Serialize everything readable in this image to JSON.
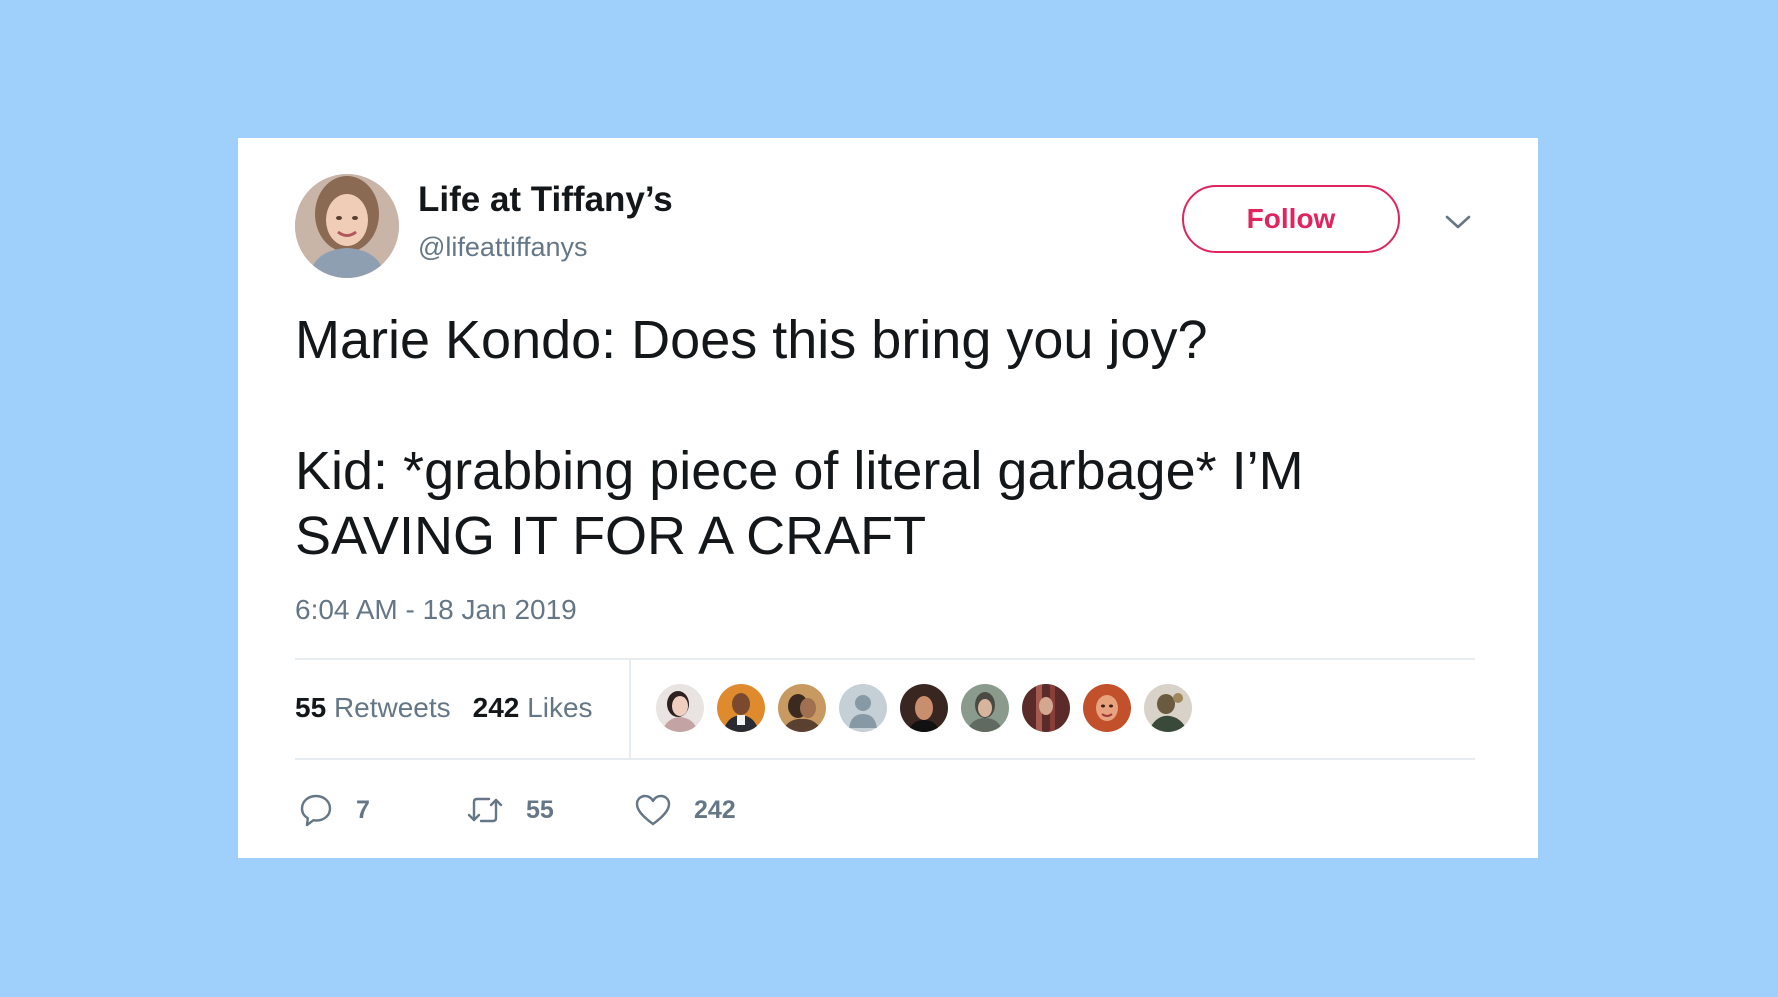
{
  "tweet": {
    "author_name": "Life at Tiffany’s",
    "author_handle": "@lifeattiffanys",
    "follow_label": "Follow",
    "text_line_1": "Marie Kondo: Does this bring you joy?",
    "text_line_2": "Kid: *grabbing piece of literal garbage* I’M SAVING IT FOR A CRAFT",
    "timestamp": "6:04 AM - 18 Jan 2019"
  },
  "stats": {
    "retweets_count": "55",
    "retweets_label": "Retweets",
    "likes_count": "242",
    "likes_label": "Likes"
  },
  "actions": {
    "reply_count": "7",
    "retweet_count": "55",
    "like_count": "242"
  },
  "liker_avatars": 9,
  "colors": {
    "background": "#9ed0fb",
    "card": "#ffffff",
    "follow_accent": "#e0245e",
    "primary_text": "#14171a",
    "secondary_text": "#657786",
    "divider": "#e6ecf0"
  },
  "icons": [
    "chevron-down-icon",
    "reply-icon",
    "retweet-icon",
    "heart-icon",
    "default-avatar-icon"
  ]
}
